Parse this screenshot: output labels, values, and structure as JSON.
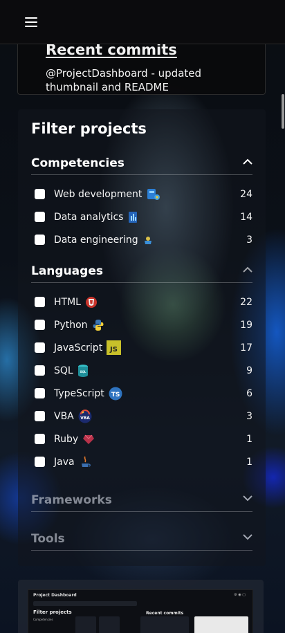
{
  "header": {
    "menu_icon": "hamburger-menu-icon"
  },
  "recent_commits": {
    "title": "Recent commits",
    "text": "@ProjectDashboard - updated thumbnail and README"
  },
  "filter": {
    "title": "Filter projects",
    "sections": {
      "competencies": {
        "title": "Competencies",
        "expanded": true,
        "items": [
          {
            "label": "Web development",
            "count": "24",
            "icon": "web-development-icon"
          },
          {
            "label": "Data analytics",
            "count": "14",
            "icon": "data-analytics-icon"
          },
          {
            "label": "Data engineering",
            "count": "3",
            "icon": "data-engineering-icon"
          }
        ]
      },
      "languages": {
        "title": "Languages",
        "expanded": true,
        "items": [
          {
            "label": "HTML",
            "count": "22",
            "icon": "html-icon"
          },
          {
            "label": "Python",
            "count": "19",
            "icon": "python-icon"
          },
          {
            "label": "JavaScript",
            "count": "17",
            "icon": "javascript-icon"
          },
          {
            "label": "SQL",
            "count": "9",
            "icon": "sql-icon"
          },
          {
            "label": "TypeScript",
            "count": "6",
            "icon": "typescript-icon"
          },
          {
            "label": "VBA",
            "count": "3",
            "icon": "vba-icon"
          },
          {
            "label": "Ruby",
            "count": "1",
            "icon": "ruby-icon"
          },
          {
            "label": "Java",
            "count": "1",
            "icon": "java-icon"
          }
        ]
      },
      "frameworks": {
        "title": "Frameworks",
        "expanded": false
      },
      "tools": {
        "title": "Tools",
        "expanded": false
      }
    }
  },
  "preview": {
    "title": "Project Dashboard",
    "filter_title": "Filter projects",
    "filter_sub": "Competencies",
    "commits_title": "Recent commits"
  },
  "colors": {
    "header_bg": "#0b0b0d",
    "panel_bg": "rgba(18,22,30,0.55)",
    "text": "#ffffff",
    "javascript_yellow": "#c8c02a",
    "typescript_blue": "#2f74c0",
    "html_red": "#c8342b"
  }
}
